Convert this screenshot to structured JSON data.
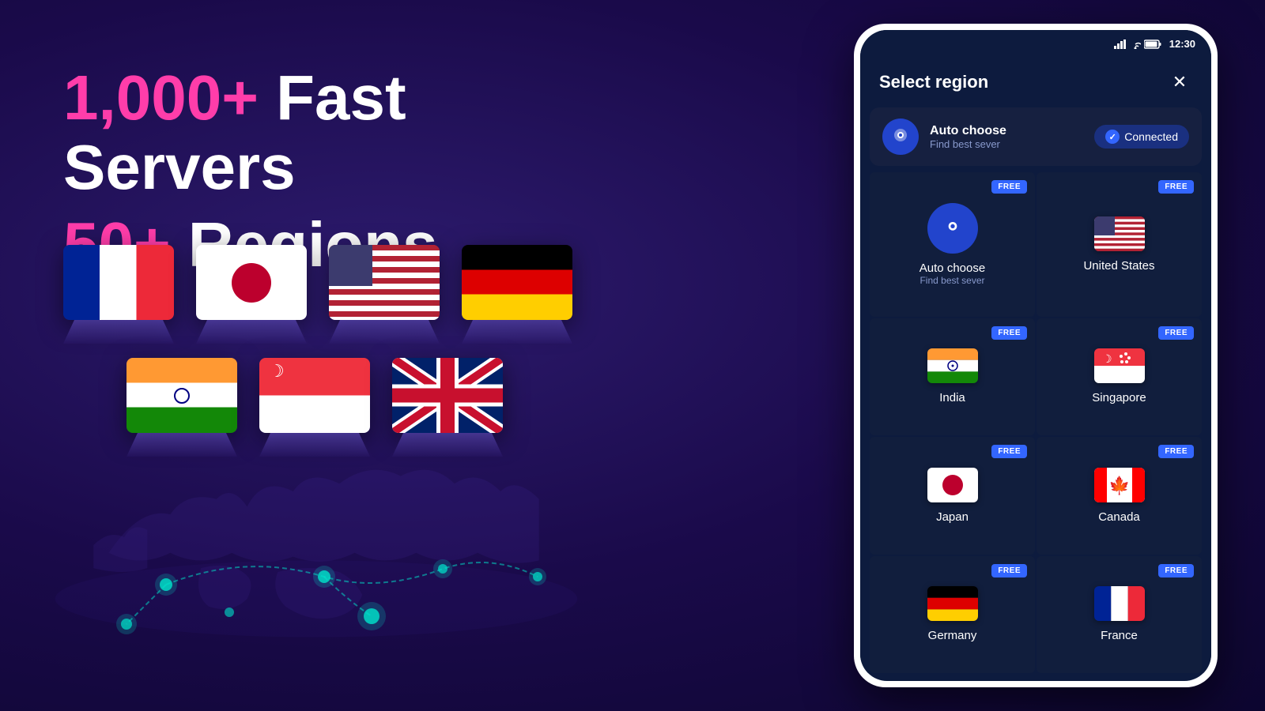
{
  "background": {
    "color": "#1a0a4a"
  },
  "left": {
    "headline_highlight": "1,000+",
    "headline_rest": " Fast Servers",
    "headline2_highlight": "50+",
    "headline2_rest": " Regions"
  },
  "flags": [
    {
      "name": "France",
      "class": "flag-france"
    },
    {
      "name": "Japan",
      "class": "flag-japan"
    },
    {
      "name": "USA",
      "class": "flag-usa"
    },
    {
      "name": "Germany",
      "class": "flag-germany"
    },
    {
      "name": "India",
      "class": "flag-india"
    },
    {
      "name": "Singapore",
      "class": "flag-singapore"
    },
    {
      "name": "UK",
      "class": "flag-uk"
    }
  ],
  "phone": {
    "status_time": "12:30",
    "dialog": {
      "title": "Select region",
      "close_label": "✕",
      "auto_choose": {
        "name": "Auto choose",
        "sub": "Find best sever",
        "connected_label": "Connected"
      },
      "regions": [
        {
          "name": "Auto choose",
          "sub": "Find best sever",
          "type": "auto",
          "badge": "FREE"
        },
        {
          "name": "United States",
          "type": "flag",
          "flag_class": "flag-mini-usa",
          "badge": "FREE"
        },
        {
          "name": "India",
          "type": "flag",
          "flag_class": "flag-mini-india",
          "badge": "FREE"
        },
        {
          "name": "Singapore",
          "type": "flag",
          "flag_class": "flag-mini-singapore",
          "badge": "FREE"
        },
        {
          "name": "Japan",
          "type": "flag",
          "flag_class": "flag-mini-japan",
          "badge": "FREE"
        },
        {
          "name": "Canada",
          "type": "flag",
          "flag_class": "flag-mini-canada",
          "badge": "FREE"
        },
        {
          "name": "Germany",
          "type": "flag",
          "flag_class": "flag-mini-germany",
          "badge": "FREE"
        },
        {
          "name": "France",
          "type": "flag",
          "flag_class": "flag-mini-france",
          "badge": "FREE"
        }
      ]
    }
  }
}
